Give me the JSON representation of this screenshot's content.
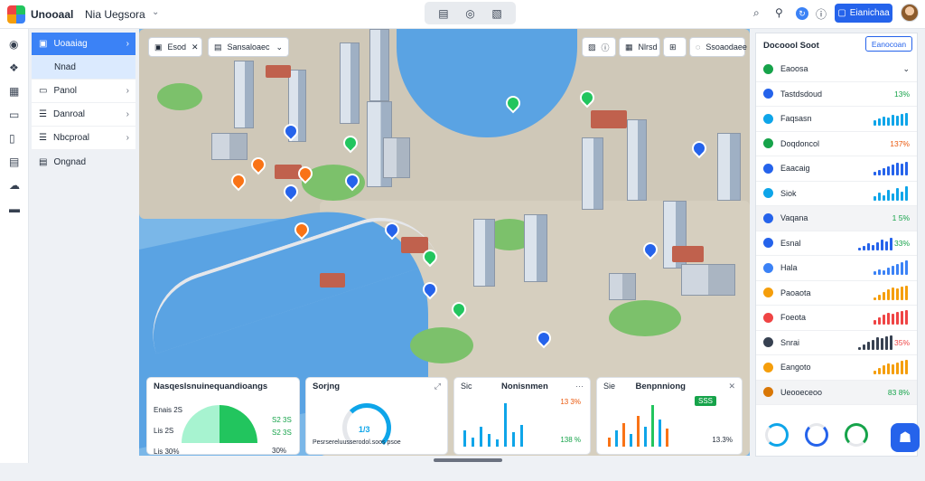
{
  "header": {
    "brand": "Unooaal",
    "workspace": "Nia  Uegsora",
    "primary_button": "Eianichaa",
    "toolbar_icons": [
      "document-icon",
      "compass-icon",
      "image-icon"
    ]
  },
  "nav": {
    "items": [
      {
        "label": "Uoaaiag",
        "active": true
      },
      {
        "label": "Nnad",
        "sub": true
      },
      {
        "label": "Panol"
      },
      {
        "label": "Danroal"
      },
      {
        "label": "Nbcproal"
      },
      {
        "label": "Ongnad"
      }
    ]
  },
  "map_chips": {
    "left": [
      {
        "label": "Esod"
      },
      {
        "label": "Sansaloaec"
      }
    ],
    "right": [
      {
        "label": "Nlrsd"
      },
      {
        "label": "Ssoaodaee"
      }
    ]
  },
  "widgets": [
    {
      "title": "Nasqeslsnuinequandioangs",
      "labels": [
        "Enais 2S",
        "Lis 2S",
        "Lis 30%"
      ],
      "legend": [
        "S2 3S",
        "S2 3S"
      ],
      "pct": "30%"
    },
    {
      "title": "Sorjng",
      "value": "1/3",
      "caption": "Pesrsereluusserodol.soos psoe"
    },
    {
      "title": "Nonisnmen",
      "prefix": "Sic",
      "value": "13 3%",
      "sub": "138 %"
    },
    {
      "title": "Benpnniong",
      "prefix": "Sie",
      "badge": "SSS",
      "value": "13.3%"
    }
  ],
  "panel": {
    "title": "Docoool Soot",
    "button": "Eanocoan",
    "rows": [
      {
        "label": "Eaoosa",
        "value": "",
        "color": "#16a34a",
        "icon": "chevron-down-icon",
        "bars": []
      },
      {
        "label": "Tastdsdoud",
        "value": "13%",
        "color": "#2563eb",
        "bars": []
      },
      {
        "label": "Faqsasn",
        "value": "",
        "color": "#0ea5e9",
        "bars": [
          6,
          8,
          10,
          9,
          12,
          11,
          13,
          14
        ]
      },
      {
        "label": "Doqdoncol",
        "value": "137%",
        "color": "#16a34a",
        "bars": []
      },
      {
        "label": "Eaacaig",
        "value": "",
        "color": "#2563eb",
        "bars": [
          4,
          6,
          8,
          10,
          12,
          14,
          13,
          15
        ]
      },
      {
        "label": "Siok",
        "value": "",
        "color": "#0ea5e9",
        "bars": [
          5,
          9,
          6,
          12,
          8,
          14,
          10,
          16
        ]
      },
      {
        "label": "Vaqana",
        "value": "1 5%",
        "color": "#2563eb",
        "bars": []
      },
      {
        "label": "Esnal",
        "value": "33%",
        "color": "#2563eb",
        "bars": [
          3,
          5,
          8,
          6,
          9,
          12,
          10,
          14
        ]
      },
      {
        "label": "Hala",
        "value": "",
        "color": "#3b82f6",
        "bars": [
          4,
          6,
          5,
          8,
          10,
          12,
          14,
          16
        ]
      },
      {
        "label": "Paoaota",
        "value": "",
        "color": "#f59e0b",
        "bars": [
          3,
          6,
          9,
          12,
          14,
          13,
          15,
          16
        ]
      },
      {
        "label": "Foeota",
        "value": "",
        "color": "#ef4444",
        "bars": [
          5,
          8,
          11,
          13,
          12,
          14,
          15,
          16
        ]
      },
      {
        "label": "Snrai",
        "value": "35%",
        "color": "#374151",
        "bars": [
          3,
          6,
          9,
          11,
          14,
          13,
          15,
          16
        ]
      },
      {
        "label": "Eangoto",
        "value": "",
        "color": "#f59e0b",
        "bars": [
          4,
          7,
          10,
          12,
          11,
          13,
          15,
          16
        ]
      },
      {
        "label": "Ueooeceoo",
        "value": "83 8%",
        "color": "#d97706",
        "bars": []
      }
    ]
  }
}
